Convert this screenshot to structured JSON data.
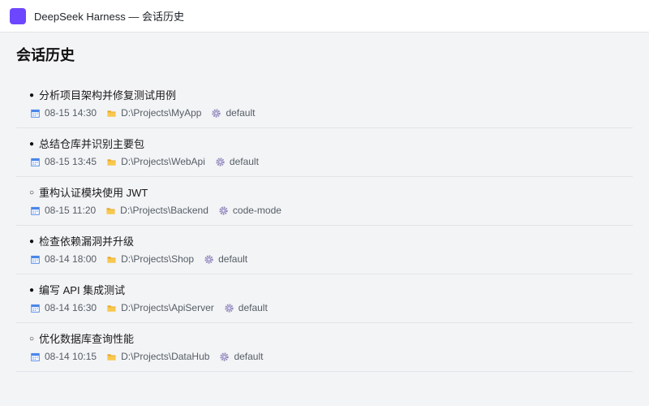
{
  "window": {
    "title": "DeepSeek Harness — 会话历史",
    "app_icon": "app-logo-icon",
    "accent": "#6c47ff"
  },
  "page": {
    "heading": "会话历史"
  },
  "meta_icons": {
    "time": "calendar-icon",
    "path": "folder-icon",
    "mode": "gear-icon"
  },
  "sessions": [
    {
      "status": "●",
      "title": "分析项目架构并修复测试用例",
      "time": "08-15 14:30",
      "path": "D:\\Projects\\MyApp",
      "mode": "default"
    },
    {
      "status": "●",
      "title": "总结仓库并识别主要包",
      "time": "08-15 13:45",
      "path": "D:\\Projects\\WebApi",
      "mode": "default"
    },
    {
      "status": "○",
      "title": "重构认证模块使用 JWT",
      "time": "08-15 11:20",
      "path": "D:\\Projects\\Backend",
      "mode": "code-mode"
    },
    {
      "status": "●",
      "title": "检查依赖漏洞并升级",
      "time": "08-14 18:00",
      "path": "D:\\Projects\\Shop",
      "mode": "default"
    },
    {
      "status": "●",
      "title": "编写 API 集成测试",
      "time": "08-14 16:30",
      "path": "D:\\Projects\\ApiServer",
      "mode": "default"
    },
    {
      "status": "○",
      "title": "优化数据库查询性能",
      "time": "08-14 10:15",
      "path": "D:\\Projects\\DataHub",
      "mode": "default"
    }
  ]
}
